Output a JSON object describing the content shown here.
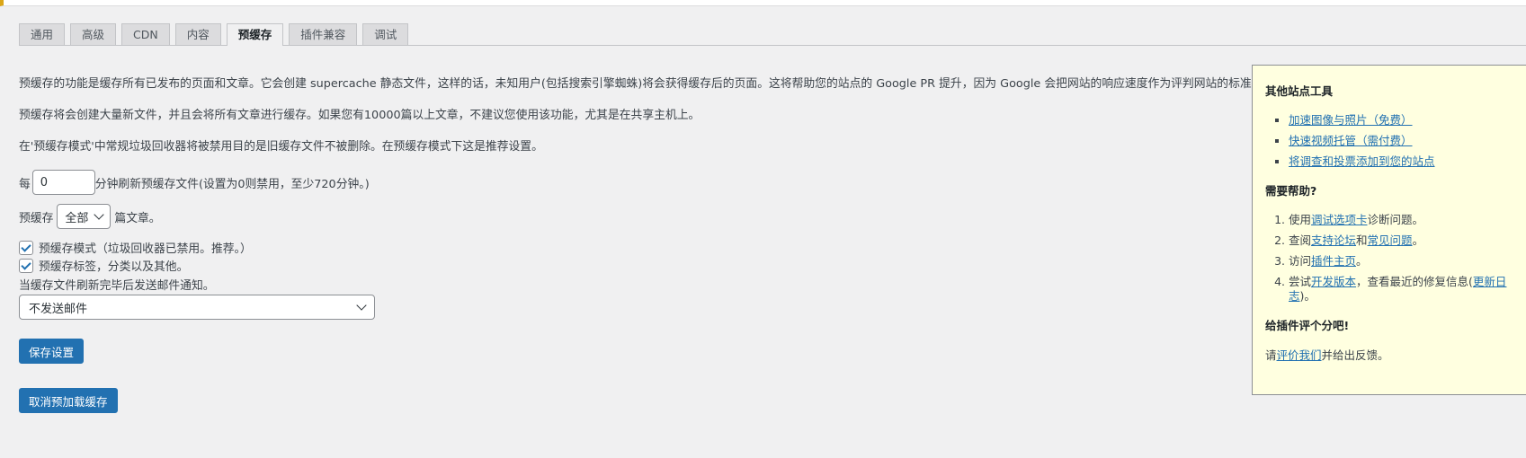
{
  "tabs": [
    "通用",
    "高级",
    "CDN",
    "内容",
    "预缓存",
    "插件兼容",
    "调试"
  ],
  "active_tab": "预缓存",
  "main": {
    "intro1": "预缓存的功能是缓存所有已发布的页面和文章。它会创建 supercache 静态文件，这样的话，未知用户(包括搜索引擎蜘蛛)将会获得缓存后的页面。这将帮助您的站点的 Google PR 提升，因为 Google 会把网站的响应速度作为评判网站的标准。",
    "intro2": "预缓存将会创建大量新文件，并且会将所有文章进行缓存。如果您有10000篇以上文章，不建议您使用该功能，尤其是在共享主机上。",
    "intro3": "在'预缓存模式'中常规垃圾回收器将被禁用目的是旧缓存文件不被删除。在预缓存模式下这是推荐设置。",
    "refresh_prefix": "每",
    "refresh_value": "0",
    "refresh_suffix": "分钟刷新预缓存文件(设置为0则禁用，至少720分钟。)",
    "posts_prefix": "预缓存",
    "posts_select": "全部",
    "posts_suffix": "篇文章。",
    "checkbox1": "预缓存模式（垃圾回收器已禁用。推荐。）",
    "checkbox2": "预缓存标签，分类以及其他。",
    "email_label": "当缓存文件刷新完毕后发送邮件通知。",
    "email_select": "不发送邮件",
    "save_button": "保存设置",
    "cancel_button": "取消预加载缓存"
  },
  "sidebar": {
    "tools_title": "其他站点工具",
    "tools": [
      "加速图像与照片（免费）",
      "快速视频托管（需付费）",
      "将调查和投票添加到您的站点"
    ],
    "help_title": "需要帮助?",
    "help1": {
      "pre": "使用",
      "link": "调试选项卡",
      "post": "诊断问题。"
    },
    "help2": {
      "pre": "查阅",
      "link1": "支持论坛",
      "mid": "和",
      "link2": "常见问题",
      "post": "。"
    },
    "help3": {
      "pre": "访问",
      "link": "插件主页",
      "post": "。"
    },
    "help4": {
      "pre": "尝试",
      "link1": "开发版本",
      "mid": "，查看最近的修复信息(",
      "link2": "更新日志",
      "post": ")。"
    },
    "rate_title": "给插件评个分吧!",
    "rate": {
      "pre": "请",
      "link": "评价我们",
      "post": "并给出反馈。"
    }
  },
  "colors": {
    "accent": "#2271b1",
    "sidebar_bg": "#ffffe0",
    "page_bg": "#f0f0f1"
  }
}
